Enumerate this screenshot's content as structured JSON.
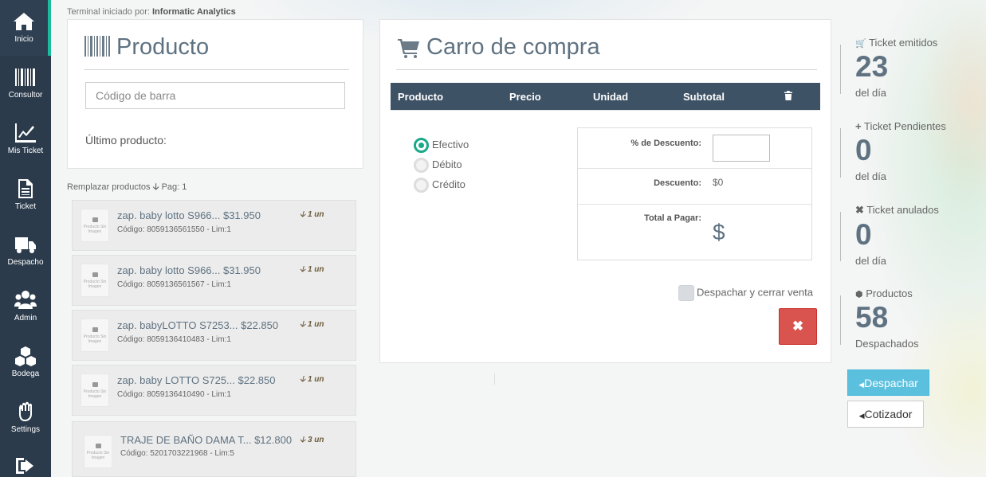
{
  "sidebar": {
    "items": [
      {
        "label": "Inicio",
        "icon": "home-icon"
      },
      {
        "label": "Consultor",
        "icon": "barcode-icon"
      },
      {
        "label": "Mis Ticket",
        "icon": "chart-line-icon"
      },
      {
        "label": "Ticket",
        "icon": "document-icon"
      },
      {
        "label": "Despacho",
        "icon": "truck-icon"
      },
      {
        "label": "Admin",
        "icon": "users-icon"
      },
      {
        "label": "Bodega",
        "icon": "cubes-icon"
      },
      {
        "label": "Settings",
        "icon": "hand-icon"
      },
      {
        "label": "",
        "icon": "sign-out-icon"
      }
    ]
  },
  "header": {
    "terminal_prefix": "Terminal iniciado por:",
    "terminal_user": "Informatic Analytics"
  },
  "producto": {
    "title": "Producto",
    "barcode_placeholder": "Código de barra",
    "last_product_label": "Último producto:"
  },
  "replace": {
    "label": "Remplazar productos",
    "page": "Pag: 1"
  },
  "products": [
    {
      "name": "zap. baby lotto S966... $31.950",
      "code": "Código: 8059136561550 - Lim:1",
      "qty": "1 un"
    },
    {
      "name": "zap. baby lotto S966... $31.950",
      "code": "Código: 8059136561567 - Lim:1",
      "qty": "1 un"
    },
    {
      "name": "zap. babyLOTTO S7253... $22.850",
      "code": "Código: 8059136410483 - Lim:1",
      "qty": "1 un"
    },
    {
      "name": "zap. baby LOTTO S725... $22.850",
      "code": "Código: 8059136410490 - Lim:1",
      "qty": "1 un"
    },
    {
      "name": "TRAJE DE BAÑO DAMA T... $12.800",
      "code": "Código: 5201703221968 - Lim:5",
      "qty": "3 un"
    }
  ],
  "thumb_text": "Producto Sin Imagen",
  "cart": {
    "title": "Carro de compra",
    "columns": [
      "Producto",
      "Precio",
      "Unidad",
      "Subtotal"
    ],
    "payment_options": [
      {
        "label": "Efectivo",
        "checked": true
      },
      {
        "label": "Débito",
        "checked": false
      },
      {
        "label": "Crédito",
        "checked": false
      }
    ],
    "discount_pct_label": "% de Descuento:",
    "discount_label": "Descuento:",
    "discount_value": "$0",
    "total_label": "Total a Pagar:",
    "total_value": "$",
    "dispatch_close_label": "Despachar y cerrar venta",
    "close_glyph": "✖"
  },
  "stats": [
    {
      "icon": "cart-icon",
      "label": "Ticket emitidos",
      "value": "23",
      "sub": "del día"
    },
    {
      "icon": "plus-icon",
      "label": "Ticket Pendientes",
      "value": "0",
      "sub": "del día"
    },
    {
      "icon": "times-icon",
      "label": "Ticket anulados",
      "value": "0",
      "sub": "del día"
    },
    {
      "icon": "cubes-icon",
      "label": "Productos",
      "value": "58",
      "sub": "Despachados"
    }
  ],
  "actions": {
    "despachar": "Despachar",
    "cotizador": "Cotizador"
  },
  "colors": {
    "sidebar": "#2b3b4c",
    "accent": "#1abc9c",
    "header": "#3e5266",
    "danger": "#d9534f",
    "info": "#5bc0de"
  }
}
